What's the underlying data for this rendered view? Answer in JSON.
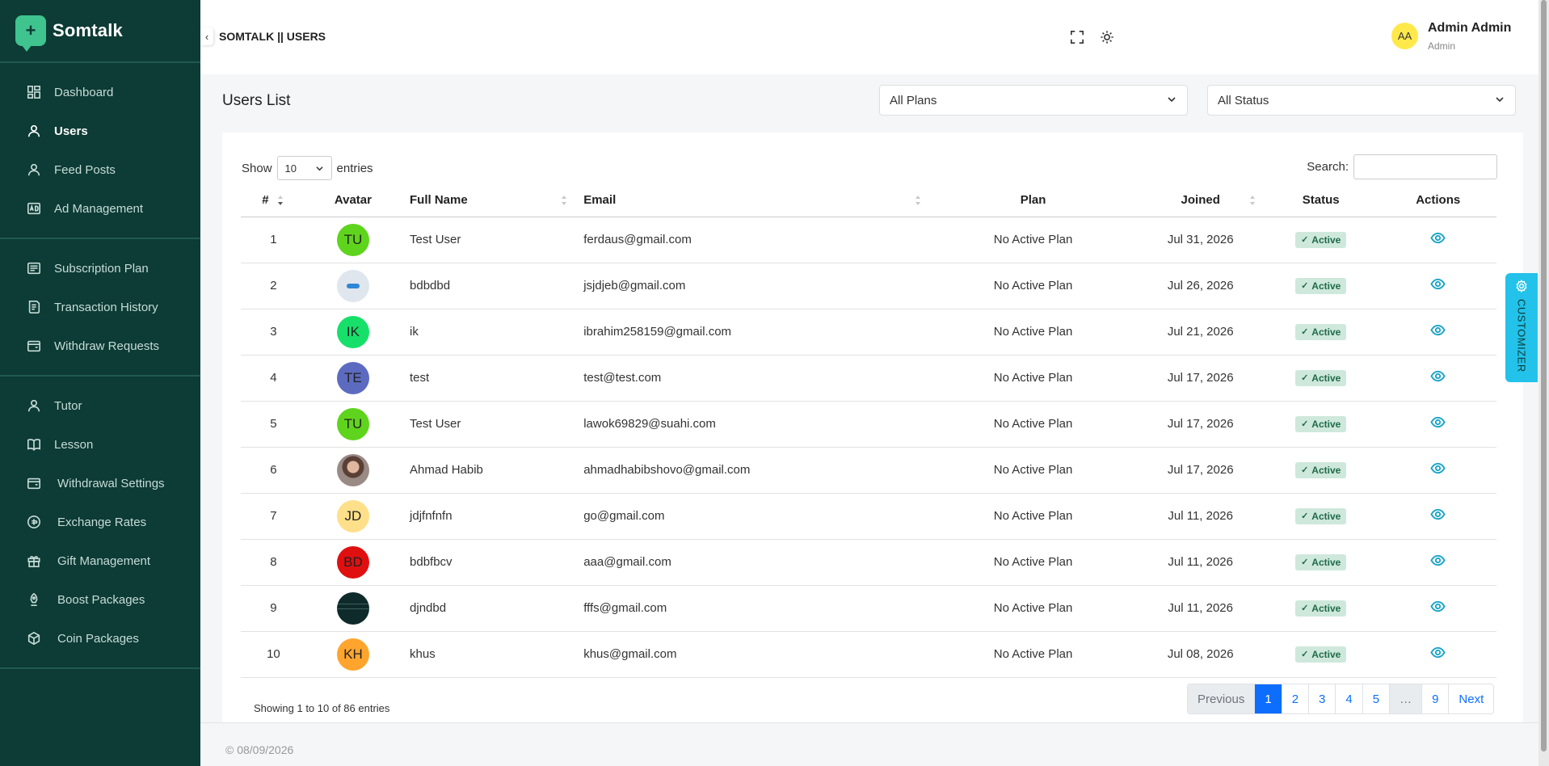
{
  "brand": {
    "name": "Somtalk",
    "logo_glyph": "+"
  },
  "sidebar": {
    "groups": [
      [
        {
          "label": "Dashboard",
          "icon": "dashboard-icon",
          "active": false
        },
        {
          "label": "Users",
          "icon": "user-icon",
          "active": true
        },
        {
          "label": "Feed Posts",
          "icon": "user-icon",
          "active": false
        },
        {
          "label": "Ad Management",
          "icon": "ad-icon",
          "active": false
        }
      ],
      [
        {
          "label": "Subscription Plan",
          "icon": "list-icon",
          "active": false
        },
        {
          "label": "Transaction History",
          "icon": "receipt-icon",
          "active": false
        },
        {
          "label": "Withdraw Requests",
          "icon": "wallet-icon",
          "active": false
        }
      ],
      [
        {
          "label": "Tutor",
          "icon": "user-icon",
          "active": false
        },
        {
          "label": "Lesson",
          "icon": "book-icon",
          "active": false
        },
        {
          "label": "Withdrawal Settings",
          "icon": "wallet-icon",
          "active": false
        },
        {
          "label": "Exchange Rates",
          "icon": "currency-icon",
          "active": false
        },
        {
          "label": "Gift Management",
          "icon": "gift-icon",
          "active": false
        },
        {
          "label": "Boost Packages",
          "icon": "rocket-icon",
          "active": false
        },
        {
          "label": "Coin Packages",
          "icon": "package-icon",
          "active": false
        }
      ]
    ]
  },
  "header": {
    "collapse_glyph": "‹",
    "title": "SOMTALK || USERS",
    "user": {
      "initials": "AA",
      "name": "Admin Admin",
      "role": "Admin"
    }
  },
  "main": {
    "title": "Users List",
    "filters": {
      "plan": "All Plans",
      "status": "All Status"
    },
    "show_label": "Show",
    "entries_value": "10",
    "entries_label": "entries",
    "search_label": "Search:",
    "search_value": ""
  },
  "table": {
    "columns": [
      "#",
      "Avatar",
      "Full Name",
      "Email",
      "Plan",
      "Joined",
      "Status",
      "Actions"
    ],
    "rows": [
      {
        "num": "1",
        "initials": "TU",
        "avatar_color": "#5fd41c",
        "name": "Test User",
        "email": "ferdaus@gmail.com",
        "plan": "No Active Plan",
        "joined": "Jul 31, 2026",
        "status": "Active"
      },
      {
        "num": "2",
        "initials": "",
        "avatar_color": "#dfe6ee",
        "avatar_kind": "logo",
        "name": "bdbdbd",
        "email": "jsjdjeb@gmail.com",
        "plan": "No Active Plan",
        "joined": "Jul 26, 2026",
        "status": "Active"
      },
      {
        "num": "3",
        "initials": "IK",
        "avatar_color": "#17e06a",
        "name": "ik",
        "email": "ibrahim258159@gmail.com",
        "plan": "No Active Plan",
        "joined": "Jul 21, 2026",
        "status": "Active"
      },
      {
        "num": "4",
        "initials": "TE",
        "avatar_color": "#5c6bc0",
        "name": "test",
        "email": "test@test.com",
        "plan": "No Active Plan",
        "joined": "Jul 17, 2026",
        "status": "Active"
      },
      {
        "num": "5",
        "initials": "TU",
        "avatar_color": "#5fd41c",
        "name": "Test User",
        "email": "lawok69829@suahi.com",
        "plan": "No Active Plan",
        "joined": "Jul 17, 2026",
        "status": "Active"
      },
      {
        "num": "6",
        "initials": "",
        "avatar_color": "#8a6a5c",
        "avatar_kind": "photo",
        "name": "Ahmad Habib",
        "email": "ahmadhabibshovo@gmail.com",
        "plan": "No Active Plan",
        "joined": "Jul 17, 2026",
        "status": "Active"
      },
      {
        "num": "7",
        "initials": "JD",
        "avatar_color": "#ffe08a",
        "name": "jdjfnfnfn",
        "email": "go@gmail.com",
        "plan": "No Active Plan",
        "joined": "Jul 11, 2026",
        "status": "Active"
      },
      {
        "num": "8",
        "initials": "BD",
        "avatar_color": "#e01010",
        "name": "bdbfbcv",
        "email": "aaa@gmail.com",
        "plan": "No Active Plan",
        "joined": "Jul 11, 2026",
        "status": "Active"
      },
      {
        "num": "9",
        "initials": "",
        "avatar_color": "#0f2a2a",
        "avatar_kind": "screenshot",
        "name": "djndbd",
        "email": "fffs@gmail.com",
        "plan": "No Active Plan",
        "joined": "Jul 11, 2026",
        "status": "Active"
      },
      {
        "num": "10",
        "initials": "KH",
        "avatar_color": "#ffa52e",
        "name": "khus",
        "email": "khus@gmail.com",
        "plan": "No Active Plan",
        "joined": "Jul 08, 2026",
        "status": "Active"
      }
    ],
    "info": "Showing 1 to 10 of 86 entries"
  },
  "pagination": {
    "previous": "Previous",
    "pages": [
      "1",
      "2",
      "3",
      "4",
      "5",
      "…",
      "9"
    ],
    "current": "1",
    "next": "Next"
  },
  "footer": {
    "text": "© 08/09/2026"
  },
  "customizer": {
    "label": "CUSTOMIZER"
  },
  "colors": {
    "sidebar_bg": "#0d3b35",
    "accent": "#0d6efd",
    "badge_bg": "#cfe8dc",
    "eye": "#19a4c9",
    "customizer": "#22c2ea"
  }
}
